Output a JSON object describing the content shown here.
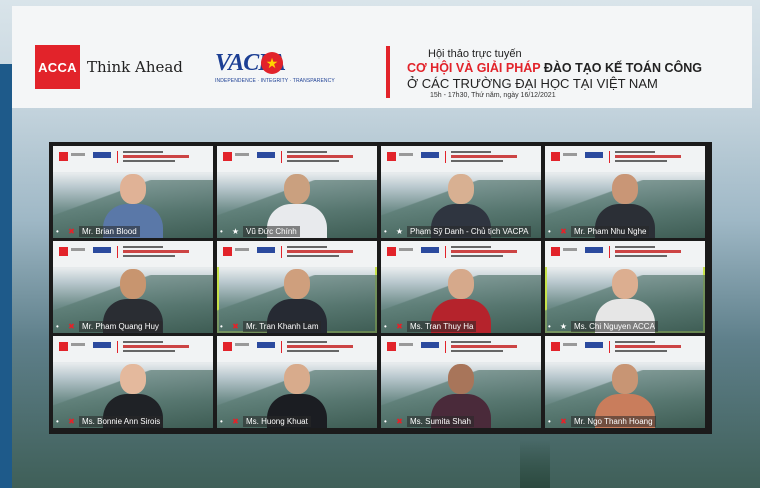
{
  "banner": {
    "acca_logo": "ACCA",
    "think_ahead": "Think Ahead",
    "vacpa_logo": "VACPA",
    "vacpa_tagline": "INDEPENDENCE · INTEGRITY · TRANSPARENCY",
    "event_subtitle": "Hội thảo trực tuyến",
    "event_title_red": "CƠ HỘI VÀ GIẢI PHÁP",
    "event_title_black": " ĐÀO TẠO KẾ TOÁN CÔNG",
    "event_title_line2": "Ở CÁC TRƯỜNG ĐẠI HỌC TẠI VIỆT NAM",
    "event_date": "15h - 17h30, Thứ năm, ngày 16/12/2021"
  },
  "participants": [
    {
      "name": "Mr. Brian Blood",
      "muted": true,
      "active": false,
      "shirt": "#5a78a8",
      "skin": "#e0b296"
    },
    {
      "name": "Vũ Đức Chính",
      "muted": false,
      "active": false,
      "shirt": "#e8eaed",
      "skin": "#caa07f"
    },
    {
      "name": "Phạm Sỹ Danh - Chủ tịch VACPA",
      "muted": false,
      "active": false,
      "shirt": "#2f3540",
      "skin": "#d8b092"
    },
    {
      "name": "Mr. Pham Nhu Nghe",
      "muted": true,
      "active": false,
      "shirt": "#2b2f36",
      "skin": "#c99676"
    },
    {
      "name": "Mr. Pham Quang Huy",
      "muted": true,
      "active": false,
      "shirt": "#2a2d33",
      "skin": "#c8956f"
    },
    {
      "name": "Mr. Tran Khanh Lam",
      "muted": true,
      "active": true,
      "shirt": "#262a33",
      "skin": "#cf9f7d"
    },
    {
      "name": "Ms. Tran Thuy Ha",
      "muted": true,
      "active": false,
      "shirt": "#b5232c",
      "skin": "#d6a98b"
    },
    {
      "name": "Ms. Chi Nguyen ACCA",
      "muted": false,
      "active": true,
      "shirt": "#e6e6e6",
      "skin": "#dcae90"
    },
    {
      "name": "Ms. Bonnie Ann Sirois",
      "muted": true,
      "active": false,
      "shirt": "#1f2226",
      "skin": "#e4b99d"
    },
    {
      "name": "Ms. Huong Khuat",
      "muted": true,
      "active": false,
      "shirt": "#1b1d22",
      "skin": "#d8ab8c"
    },
    {
      "name": "Ms. Sumita Shah",
      "muted": true,
      "active": false,
      "shirt": "#4a2a3a",
      "skin": "#a8755a"
    },
    {
      "name": "Mr. Ngo Thanh Hoang",
      "muted": true,
      "active": false,
      "shirt": "#c97d5c",
      "skin": "#c89574"
    }
  ]
}
